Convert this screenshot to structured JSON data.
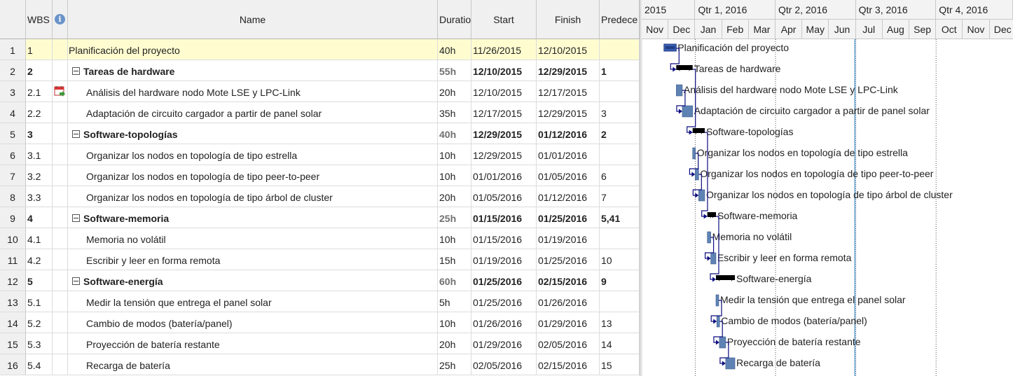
{
  "columns": {
    "wbs": "WBS",
    "indicators_icon": "info-icon",
    "name": "Name",
    "duration": "Duratio",
    "start": "Start",
    "finish": "Finish",
    "predecessors": "Predece"
  },
  "timeline": {
    "quarters": [
      "2015",
      "Qtr 1, 2016",
      "Qtr 2, 2016",
      "Qtr 3, 2016",
      "Qtr 4, 2016"
    ],
    "months": [
      "Nov",
      "Dec",
      "Jan",
      "Feb",
      "Mar",
      "Apr",
      "May",
      "Jun",
      "Jul",
      "Aug",
      "Sep",
      "Oct",
      "Nov",
      "Dec"
    ],
    "current_date_line": "2016-06-30"
  },
  "colors": {
    "selected_row": "#fffdd0",
    "task_bar": "#5f82b4",
    "summary_bar": "#000000",
    "project_summary_bar": "#203d88",
    "link_line": "#0c0c80",
    "current_date_line": "#7fb0d8"
  },
  "tasks": [
    {
      "id": "1",
      "wbs": "1",
      "name": "Planificación del proyecto",
      "duration": "40h",
      "start": "11/26/2015",
      "finish": "12/10/2015",
      "pred": "",
      "level": 0,
      "type": "project",
      "selected": true
    },
    {
      "id": "2",
      "wbs": "2",
      "name": "Tareas de hardware",
      "duration": "55h",
      "start": "12/10/2015",
      "finish": "12/29/2015",
      "pred": "1",
      "level": 1,
      "type": "summary"
    },
    {
      "id": "3",
      "wbs": "2.1",
      "name": "Análisis del hardware nodo Mote LSE y LPC-Link",
      "duration": "20h",
      "start": "12/10/2015",
      "finish": "12/17/2015",
      "pred": "",
      "level": 2,
      "type": "task",
      "indicator": "calendar-icon"
    },
    {
      "id": "4",
      "wbs": "2.2",
      "name": "Adaptación de circuito cargador a partir de panel solar",
      "duration": "35h",
      "start": "12/17/2015",
      "finish": "12/29/2015",
      "pred": "3",
      "level": 2,
      "type": "task"
    },
    {
      "id": "5",
      "wbs": "3",
      "name": "Software-topologías",
      "duration": "40h",
      "start": "12/29/2015",
      "finish": "01/12/2016",
      "pred": "2",
      "level": 1,
      "type": "summary"
    },
    {
      "id": "6",
      "wbs": "3.1",
      "name": "Organizar los nodos en topología de tipo estrella",
      "duration": "10h",
      "start": "12/29/2015",
      "finish": "01/01/2016",
      "pred": "",
      "level": 2,
      "type": "task"
    },
    {
      "id": "7",
      "wbs": "3.2",
      "name": "Organizar los nodos en topología de tipo peer-to-peer",
      "duration": "10h",
      "start": "01/01/2016",
      "finish": "01/05/2016",
      "pred": "6",
      "level": 2,
      "type": "task"
    },
    {
      "id": "8",
      "wbs": "3.3",
      "name": "Organizar los nodos en topología de tipo árbol de cluster",
      "duration": "20h",
      "start": "01/05/2016",
      "finish": "01/12/2016",
      "pred": "7",
      "level": 2,
      "type": "task"
    },
    {
      "id": "9",
      "wbs": "4",
      "name": "Software-memoria",
      "duration": "25h",
      "start": "01/15/2016",
      "finish": "01/25/2016",
      "pred": "5,41",
      "level": 1,
      "type": "summary"
    },
    {
      "id": "10",
      "wbs": "4.1",
      "name": "Memoria no volátil",
      "duration": "10h",
      "start": "01/15/2016",
      "finish": "01/19/2016",
      "pred": "",
      "level": 2,
      "type": "task"
    },
    {
      "id": "11",
      "wbs": "4.2",
      "name": "Escribir y leer en forma remota",
      "duration": "15h",
      "start": "01/19/2016",
      "finish": "01/25/2016",
      "pred": "10",
      "level": 2,
      "type": "task"
    },
    {
      "id": "12",
      "wbs": "5",
      "name": "Software-energía",
      "duration": "60h",
      "start": "01/25/2016",
      "finish": "02/15/2016",
      "pred": "9",
      "level": 1,
      "type": "summary"
    },
    {
      "id": "13",
      "wbs": "5.1",
      "name": "Medir la tensión que entrega el panel solar",
      "duration": "5h",
      "start": "01/25/2016",
      "finish": "01/26/2016",
      "pred": "",
      "level": 2,
      "type": "task"
    },
    {
      "id": "14",
      "wbs": "5.2",
      "name": "Cambio de modos (batería/panel)",
      "duration": "10h",
      "start": "01/26/2016",
      "finish": "01/29/2016",
      "pred": "13",
      "level": 2,
      "type": "task"
    },
    {
      "id": "15",
      "wbs": "5.3",
      "name": "Proyección de batería restante",
      "duration": "20h",
      "start": "01/29/2016",
      "finish": "02/05/2016",
      "pred": "14",
      "level": 2,
      "type": "task"
    },
    {
      "id": "16",
      "wbs": "5.4",
      "name": "Recarga de batería",
      "duration": "25h",
      "start": "02/05/2016",
      "finish": "02/15/2016",
      "pred": "15",
      "level": 2,
      "type": "task"
    }
  ]
}
